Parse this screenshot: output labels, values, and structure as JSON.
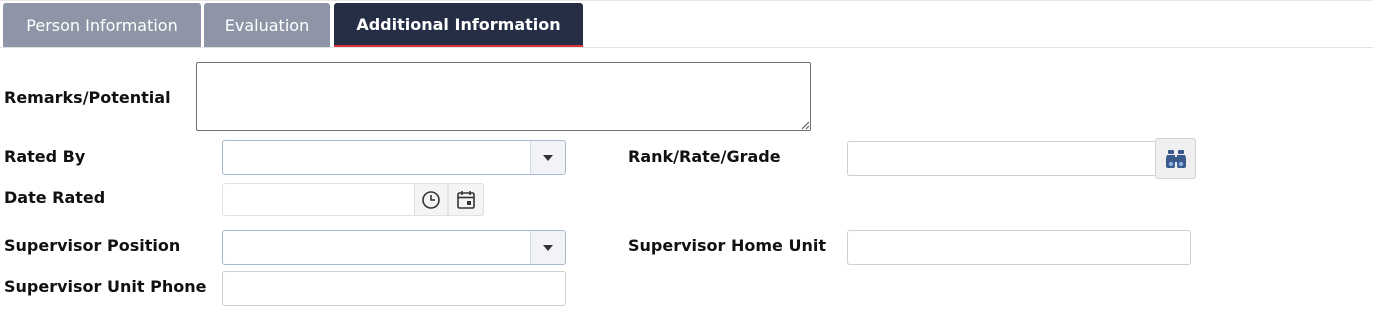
{
  "tabs": [
    {
      "label": "Person Information",
      "active": false
    },
    {
      "label": "Evaluation",
      "active": false
    },
    {
      "label": "Additional Information",
      "active": true
    }
  ],
  "form": {
    "remarks": {
      "label": "Remarks/Potential",
      "value": ""
    },
    "rated_by": {
      "label": "Rated By",
      "value": ""
    },
    "rank_rate_grade": {
      "label": "Rank/Rate/Grade",
      "value": ""
    },
    "date_rated": {
      "label": "Date Rated",
      "value": ""
    },
    "supervisor_position": {
      "label": "Supervisor Position",
      "value": ""
    },
    "supervisor_home_unit": {
      "label": "Supervisor Home Unit",
      "value": ""
    },
    "supervisor_unit_phone": {
      "label": "Supervisor Unit Phone",
      "value": ""
    }
  },
  "icons": {
    "dropdown": "caret-down-icon",
    "lookup": "binoculars-icon",
    "time": "clock-icon",
    "date": "calendar-icon"
  },
  "colors": {
    "tab_inactive": "#8e95a6",
    "tab_active": "#262e45",
    "tab_active_underline": "#d9333a",
    "select_border": "#a9b9cf",
    "lookup_icon": "#3a5a8c"
  }
}
